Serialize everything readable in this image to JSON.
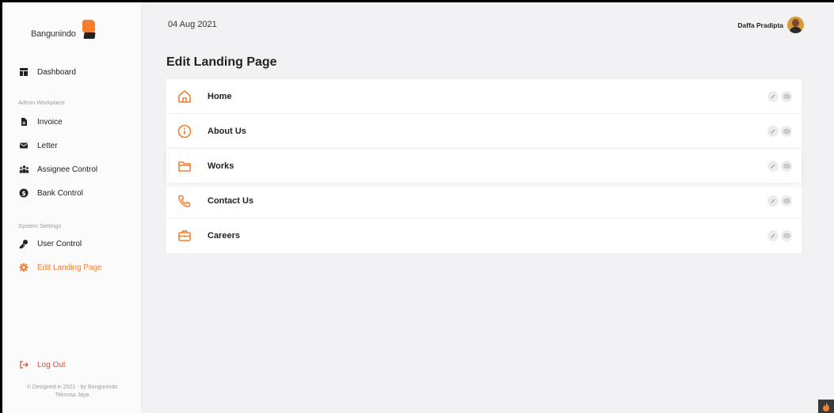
{
  "brand": {
    "name": "Bangunindo"
  },
  "sidebar": {
    "dashboard": "Dashboard",
    "section_admin": "Admin Workplace",
    "admin_items": [
      "Invoice",
      "Letter",
      "Assignee Control",
      "Bank Control"
    ],
    "section_system": "System Settings",
    "system_items": [
      "User Control",
      "Edit Landing Page"
    ],
    "logout": "Log Out",
    "footer_line1": "© Designed in 2021 - by Bangunindo",
    "footer_line2": "Teknusa Jaya"
  },
  "header": {
    "date": "04 Aug 2021",
    "user_name": "Daffa Pradipta"
  },
  "main": {
    "title": "Edit Landing Page",
    "rows": [
      {
        "label": "Home",
        "icon": "home-icon"
      },
      {
        "label": "About Us",
        "icon": "info-icon"
      },
      {
        "label": "Works",
        "icon": "folder-icon"
      },
      {
        "label": "Contact Us",
        "icon": "phone-icon"
      },
      {
        "label": "Careers",
        "icon": "briefcase-icon"
      }
    ]
  },
  "colors": {
    "accent": "#f47e2f",
    "logout": "#e84e3c",
    "background": "#f2f2f4"
  }
}
